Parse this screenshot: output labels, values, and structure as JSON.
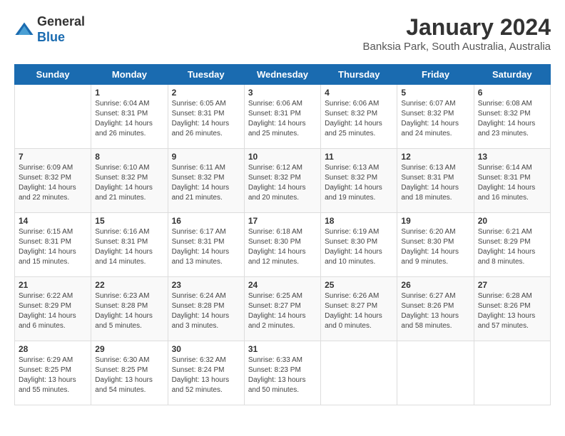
{
  "header": {
    "logo_general": "General",
    "logo_blue": "Blue",
    "month_title": "January 2024",
    "location": "Banksia Park, South Australia, Australia"
  },
  "days_of_week": [
    "Sunday",
    "Monday",
    "Tuesday",
    "Wednesday",
    "Thursday",
    "Friday",
    "Saturday"
  ],
  "weeks": [
    [
      {
        "day": "",
        "info": ""
      },
      {
        "day": "1",
        "info": "Sunrise: 6:04 AM\nSunset: 8:31 PM\nDaylight: 14 hours\nand 26 minutes."
      },
      {
        "day": "2",
        "info": "Sunrise: 6:05 AM\nSunset: 8:31 PM\nDaylight: 14 hours\nand 26 minutes."
      },
      {
        "day": "3",
        "info": "Sunrise: 6:06 AM\nSunset: 8:31 PM\nDaylight: 14 hours\nand 25 minutes."
      },
      {
        "day": "4",
        "info": "Sunrise: 6:06 AM\nSunset: 8:32 PM\nDaylight: 14 hours\nand 25 minutes."
      },
      {
        "day": "5",
        "info": "Sunrise: 6:07 AM\nSunset: 8:32 PM\nDaylight: 14 hours\nand 24 minutes."
      },
      {
        "day": "6",
        "info": "Sunrise: 6:08 AM\nSunset: 8:32 PM\nDaylight: 14 hours\nand 23 minutes."
      }
    ],
    [
      {
        "day": "7",
        "info": "Sunrise: 6:09 AM\nSunset: 8:32 PM\nDaylight: 14 hours\nand 22 minutes."
      },
      {
        "day": "8",
        "info": "Sunrise: 6:10 AM\nSunset: 8:32 PM\nDaylight: 14 hours\nand 21 minutes."
      },
      {
        "day": "9",
        "info": "Sunrise: 6:11 AM\nSunset: 8:32 PM\nDaylight: 14 hours\nand 21 minutes."
      },
      {
        "day": "10",
        "info": "Sunrise: 6:12 AM\nSunset: 8:32 PM\nDaylight: 14 hours\nand 20 minutes."
      },
      {
        "day": "11",
        "info": "Sunrise: 6:13 AM\nSunset: 8:32 PM\nDaylight: 14 hours\nand 19 minutes."
      },
      {
        "day": "12",
        "info": "Sunrise: 6:13 AM\nSunset: 8:31 PM\nDaylight: 14 hours\nand 18 minutes."
      },
      {
        "day": "13",
        "info": "Sunrise: 6:14 AM\nSunset: 8:31 PM\nDaylight: 14 hours\nand 16 minutes."
      }
    ],
    [
      {
        "day": "14",
        "info": "Sunrise: 6:15 AM\nSunset: 8:31 PM\nDaylight: 14 hours\nand 15 minutes."
      },
      {
        "day": "15",
        "info": "Sunrise: 6:16 AM\nSunset: 8:31 PM\nDaylight: 14 hours\nand 14 minutes."
      },
      {
        "day": "16",
        "info": "Sunrise: 6:17 AM\nSunset: 8:31 PM\nDaylight: 14 hours\nand 13 minutes."
      },
      {
        "day": "17",
        "info": "Sunrise: 6:18 AM\nSunset: 8:30 PM\nDaylight: 14 hours\nand 12 minutes."
      },
      {
        "day": "18",
        "info": "Sunrise: 6:19 AM\nSunset: 8:30 PM\nDaylight: 14 hours\nand 10 minutes."
      },
      {
        "day": "19",
        "info": "Sunrise: 6:20 AM\nSunset: 8:30 PM\nDaylight: 14 hours\nand 9 minutes."
      },
      {
        "day": "20",
        "info": "Sunrise: 6:21 AM\nSunset: 8:29 PM\nDaylight: 14 hours\nand 8 minutes."
      }
    ],
    [
      {
        "day": "21",
        "info": "Sunrise: 6:22 AM\nSunset: 8:29 PM\nDaylight: 14 hours\nand 6 minutes."
      },
      {
        "day": "22",
        "info": "Sunrise: 6:23 AM\nSunset: 8:28 PM\nDaylight: 14 hours\nand 5 minutes."
      },
      {
        "day": "23",
        "info": "Sunrise: 6:24 AM\nSunset: 8:28 PM\nDaylight: 14 hours\nand 3 minutes."
      },
      {
        "day": "24",
        "info": "Sunrise: 6:25 AM\nSunset: 8:27 PM\nDaylight: 14 hours\nand 2 minutes."
      },
      {
        "day": "25",
        "info": "Sunrise: 6:26 AM\nSunset: 8:27 PM\nDaylight: 14 hours\nand 0 minutes."
      },
      {
        "day": "26",
        "info": "Sunrise: 6:27 AM\nSunset: 8:26 PM\nDaylight: 13 hours\nand 58 minutes."
      },
      {
        "day": "27",
        "info": "Sunrise: 6:28 AM\nSunset: 8:26 PM\nDaylight: 13 hours\nand 57 minutes."
      }
    ],
    [
      {
        "day": "28",
        "info": "Sunrise: 6:29 AM\nSunset: 8:25 PM\nDaylight: 13 hours\nand 55 minutes."
      },
      {
        "day": "29",
        "info": "Sunrise: 6:30 AM\nSunset: 8:25 PM\nDaylight: 13 hours\nand 54 minutes."
      },
      {
        "day": "30",
        "info": "Sunrise: 6:32 AM\nSunset: 8:24 PM\nDaylight: 13 hours\nand 52 minutes."
      },
      {
        "day": "31",
        "info": "Sunrise: 6:33 AM\nSunset: 8:23 PM\nDaylight: 13 hours\nand 50 minutes."
      },
      {
        "day": "",
        "info": ""
      },
      {
        "day": "",
        "info": ""
      },
      {
        "day": "",
        "info": ""
      }
    ]
  ]
}
